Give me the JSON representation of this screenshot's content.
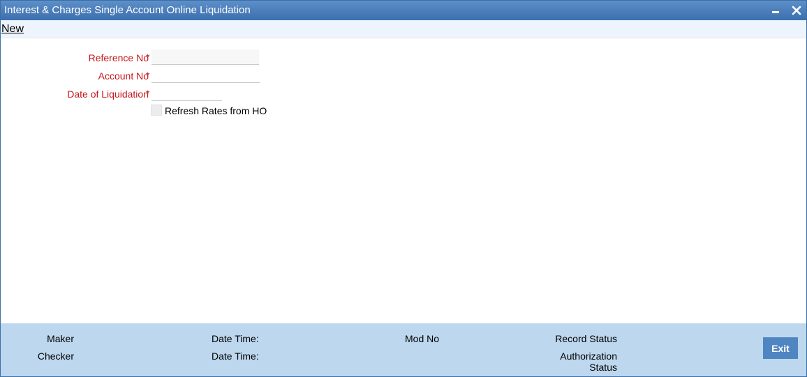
{
  "window": {
    "title": "Interest & Charges Single Account Online Liquidation"
  },
  "toolbar": {
    "new_label": "New"
  },
  "form": {
    "reference_no": {
      "label": "Reference No",
      "required_mark": "*",
      "value": ""
    },
    "account_no": {
      "label": "Account No",
      "required_mark": "*",
      "value": ""
    },
    "date_of_liquidation": {
      "label": "Date of Liquidation",
      "required_mark": "*",
      "value": ""
    },
    "refresh_rates": {
      "label": "Refresh Rates from HO",
      "checked": false
    }
  },
  "footer": {
    "maker_label": "Maker",
    "checker_label": "Checker",
    "maker_datetime_label": "Date Time:",
    "checker_datetime_label": "Date Time:",
    "mod_no_label": "Mod No",
    "record_status_label": "Record Status",
    "authorization_status_label_line1": "Authorization",
    "authorization_status_label_line2": "Status",
    "exit_label": "Exit"
  },
  "colors": {
    "title_bar": "#4a7db9",
    "required_label": "#c4161c",
    "footer_bg": "#bdd7ee",
    "exit_button": "#4f86c2"
  }
}
